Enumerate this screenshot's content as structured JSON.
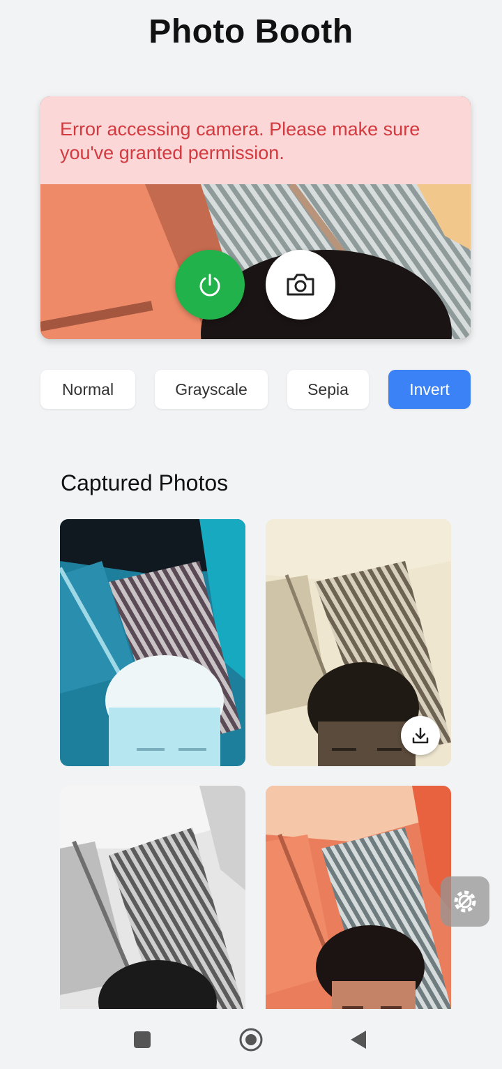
{
  "app": {
    "title": "Photo Booth"
  },
  "camera": {
    "error_message": "Error accessing camera. Please make sure you've granted permission.",
    "power_icon": "power-icon",
    "capture_icon": "camera-icon"
  },
  "filters": [
    {
      "label": "Normal",
      "active": false
    },
    {
      "label": "Grayscale",
      "active": false
    },
    {
      "label": "Sepia",
      "active": false
    },
    {
      "label": "Invert",
      "active": true
    }
  ],
  "gallery": {
    "title": "Captured Photos",
    "photos": [
      {
        "filter": "invert"
      },
      {
        "filter": "sepia",
        "download_icon": "download-icon"
      },
      {
        "filter": "grayscale"
      },
      {
        "filter": "normal"
      }
    ]
  },
  "colors": {
    "accent": "#3b82f6",
    "power": "#22b24c",
    "error_bg": "#fbd7d8",
    "error_text": "#d23a3f"
  },
  "system_nav": [
    "recents-icon",
    "home-icon",
    "back-icon"
  ]
}
